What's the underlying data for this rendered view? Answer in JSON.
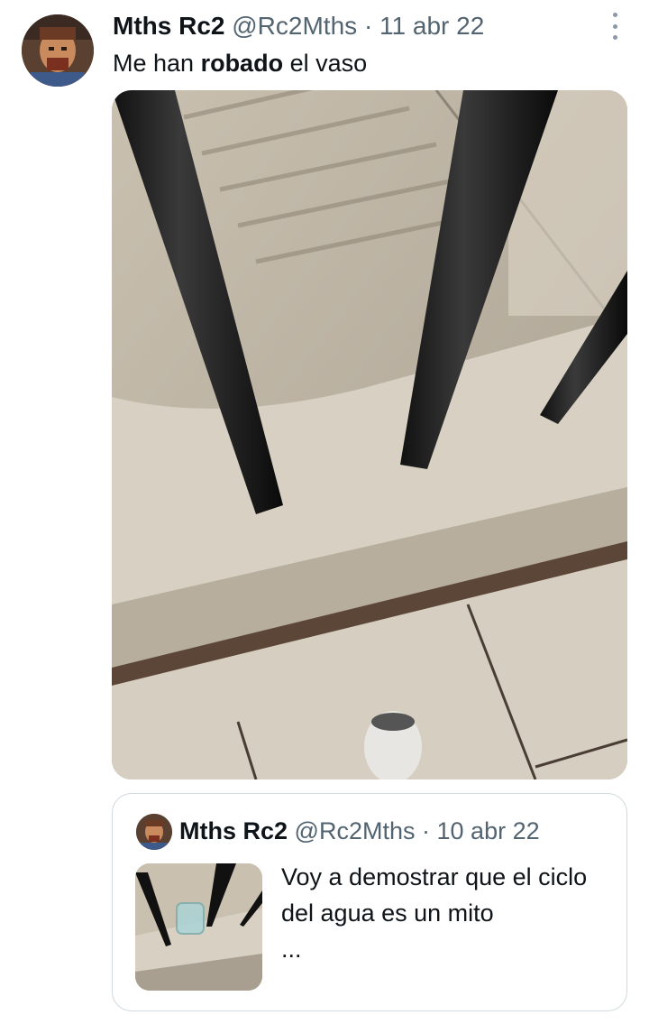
{
  "tweet": {
    "author_name": "Mths Rc2",
    "handle": "@Rc2Mths",
    "separator": "·",
    "date": "11 abr 22",
    "text_before": "Me han ",
    "text_bold": "robado",
    "text_after": " el vaso",
    "more_icon": "vertical-ellipsis-icon",
    "media_description_icon": "photo"
  },
  "quoted_tweet": {
    "author_name": "Mths Rc2",
    "handle": "@Rc2Mths",
    "separator": "·",
    "date": "10 abr 22",
    "text": "Voy a demostrar que el ciclo del agua es un mito",
    "ellipsis": "..."
  },
  "colors": {
    "text_primary": "#0f1419",
    "text_secondary": "#536471",
    "border": "#cfd9de"
  }
}
